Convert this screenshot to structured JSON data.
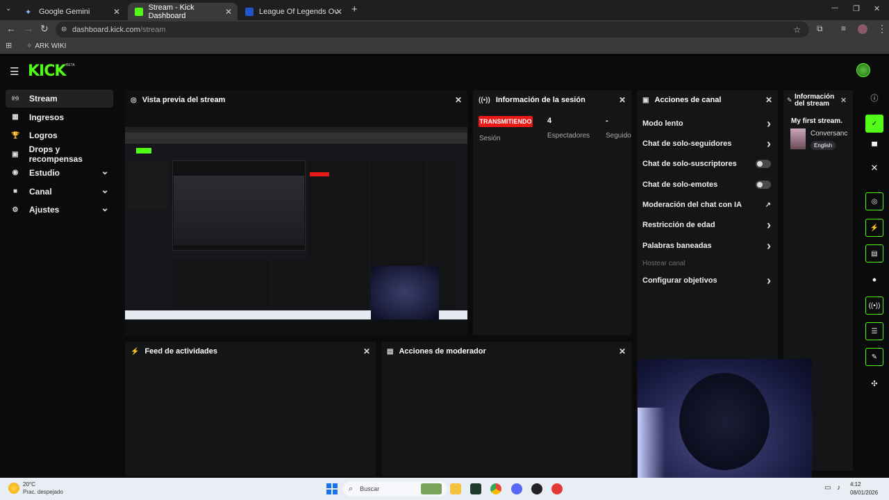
{
  "browser": {
    "tabs": [
      {
        "label": "Google Gemini",
        "active": false
      },
      {
        "label": "Stream - Kick Dashboard",
        "active": true
      },
      {
        "label": "League Of Legends Overlay Pro",
        "active": false
      }
    ],
    "new_tab": "+",
    "url_host": "dashboard.kick.com",
    "url_path": "/stream",
    "bookmark": "ARK WIKI",
    "window_controls": {
      "minimize": "—",
      "maximize": "❐",
      "close": "✕"
    }
  },
  "app": {
    "logo": "KICK",
    "logo_badge": "BETA",
    "sidebar": [
      {
        "label": "Stream",
        "icon": "broadcast-icon",
        "glyph": "((•))",
        "active": true,
        "chevron": false
      },
      {
        "label": "Ingresos",
        "icon": "revenue-icon",
        "glyph": "▦",
        "active": false,
        "chevron": false
      },
      {
        "label": "Logros",
        "icon": "trophy-icon",
        "glyph": "🏆",
        "active": false,
        "chevron": false
      },
      {
        "label": "Drops y recompensas",
        "icon": "gift-icon",
        "glyph": "▣",
        "active": false,
        "chevron": false
      },
      {
        "label": "Estudio",
        "icon": "studio-icon",
        "glyph": "◉",
        "active": false,
        "chevron": true
      },
      {
        "label": "Canal",
        "icon": "channel-icon",
        "glyph": "■",
        "active": false,
        "chevron": true
      },
      {
        "label": "Ajustes",
        "icon": "settings-icon",
        "glyph": "⚙",
        "active": false,
        "chevron": true
      }
    ],
    "preview": {
      "title": "Vista previa del stream"
    },
    "session": {
      "title": "Información de la sesión",
      "status_badge": "TRANSMITIENDO",
      "session_label": "Sesión",
      "viewers_value": "4",
      "viewers_label": "Espectadores",
      "followers_value": "-",
      "followers_label": "Seguido"
    },
    "channel_actions": {
      "title": "Acciones de canal",
      "items": [
        {
          "label": "Modo lento",
          "control": "chevron"
        },
        {
          "label": "Chat de solo-seguidores",
          "control": "chevron"
        },
        {
          "label": "Chat de solo-suscriptores",
          "control": "toggle"
        },
        {
          "label": "Chat de solo-emotes",
          "control": "toggle"
        },
        {
          "label": "Moderación del chat con IA",
          "control": "external"
        },
        {
          "label": "Restricción de edad",
          "control": "chevron"
        },
        {
          "label": "Palabras baneadas",
          "control": "chevron"
        },
        {
          "label": "Hostear canal",
          "control": "none",
          "disabled": true
        },
        {
          "label": "Configurar objetivos",
          "control": "chevron"
        }
      ]
    },
    "stream_info": {
      "title_line1": "Información",
      "title_line2": "del stream",
      "stream_title": "My first stream.",
      "category": "Conversanc",
      "language": "English"
    },
    "activity_feed": {
      "title": "Feed de actividades"
    },
    "mod_actions": {
      "title": "Acciones de moderador"
    }
  },
  "taskbar": {
    "weather_temp": "20°C",
    "weather_desc": "Prac. despejado",
    "search_placeholder": "Buscar",
    "time": "4:12",
    "date": "08/01/2026"
  },
  "colors": {
    "accent": "#53fc18",
    "live_red": "#e91916",
    "panel": "#141516",
    "bg": "#0b0b0b"
  }
}
